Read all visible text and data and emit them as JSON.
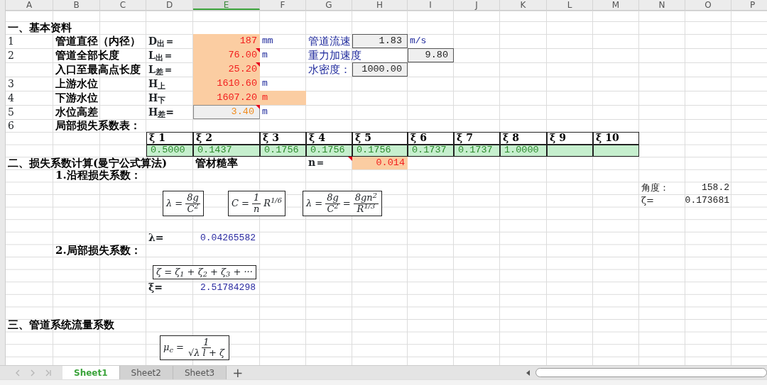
{
  "columns": [
    {
      "label": "A",
      "selected": false
    },
    {
      "label": "B",
      "selected": false
    },
    {
      "label": "C",
      "selected": false
    },
    {
      "label": "D",
      "selected": false
    },
    {
      "label": "E",
      "selected": true
    },
    {
      "label": "F",
      "selected": false
    },
    {
      "label": "G",
      "selected": false
    },
    {
      "label": "H",
      "selected": false
    },
    {
      "label": "I",
      "selected": false
    },
    {
      "label": "J",
      "selected": false
    },
    {
      "label": "K",
      "selected": false
    },
    {
      "label": "L",
      "selected": false
    },
    {
      "label": "M",
      "selected": false
    },
    {
      "label": "N",
      "selected": false
    },
    {
      "label": "O",
      "selected": false
    },
    {
      "label": "P",
      "selected": false
    }
  ],
  "rows": [
    {},
    {
      "cells": [
        {
          "kind": "heading",
          "text": "一、基本资料"
        }
      ]
    },
    {
      "cells": [
        {
          "kind": "index",
          "text": "1"
        },
        {
          "kind": "label",
          "text": "管道直径（内径）"
        },
        {},
        {
          "kind": "symbol",
          "text": "D$_{出}$＝"
        },
        {
          "kind": "input",
          "text": "187"
        },
        {
          "kind": "unit",
          "text": "mm"
        },
        {
          "kind": "blue-label",
          "text": "管道流速"
        },
        {
          "kind": "computed",
          "text": "1.83"
        },
        {
          "kind": "unit",
          "text": "m/s"
        }
      ]
    },
    {
      "cells": [
        {
          "kind": "index",
          "text": "2"
        },
        {
          "kind": "label",
          "text": "管道全部长度"
        },
        {},
        {
          "kind": "symbol",
          "text": "L$_{出}$＝"
        },
        {
          "kind": "input",
          "text": "76.00",
          "comment": true
        },
        {
          "kind": "unit",
          "text": "m"
        },
        {
          "kind": "blue-label",
          "text": "重力加速度"
        },
        {},
        {
          "kind": "computed",
          "text": "9.80"
        }
      ]
    },
    {
      "cells": [
        {},
        {
          "kind": "label",
          "text": "入口至最高点长度"
        },
        {},
        {
          "kind": "symbol",
          "text": "L$_{差}$＝"
        },
        {
          "kind": "input",
          "text": "25.20",
          "comment": true
        },
        {},
        {
          "kind": "blue-label",
          "text": "水密度："
        },
        {
          "kind": "computed",
          "text": "1000.00"
        }
      ]
    },
    {
      "cells": [
        {
          "kind": "index",
          "text": "3"
        },
        {
          "kind": "label",
          "text": "上游水位"
        },
        {},
        {
          "kind": "symbol",
          "text": "H$_{上}$"
        },
        {
          "kind": "input",
          "text": "1610.60"
        },
        {
          "kind": "unit",
          "text": "m"
        }
      ]
    },
    {
      "cells": [
        {
          "kind": "index",
          "text": "4"
        },
        {
          "kind": "label",
          "text": "下游水位"
        },
        {},
        {
          "kind": "symbol",
          "text": "H$_{下}$"
        },
        {
          "kind": "input",
          "text": "1607.20"
        },
        {
          "kind": "input-unit",
          "text": "m"
        }
      ]
    },
    {
      "cells": [
        {
          "kind": "index",
          "text": "5"
        },
        {
          "kind": "label",
          "text": "水位高差"
        },
        {},
        {
          "kind": "symbol",
          "text": "H$_{差}$="
        },
        {
          "kind": "computed-warn",
          "text": "3.40",
          "comment": true
        },
        {
          "kind": "unit",
          "text": "m"
        }
      ]
    },
    {
      "cells": [
        {
          "kind": "index",
          "text": "6"
        },
        {
          "kind": "label",
          "text": "局部损失系数表："
        }
      ]
    },
    {
      "cells": [
        {},
        {},
        {},
        {
          "kind": "coef-head",
          "text": "ξ 1"
        },
        {
          "kind": "coef-head",
          "text": "ξ 2"
        },
        {
          "kind": "coef-head",
          "text": "ξ 3"
        },
        {
          "kind": "coef-head",
          "text": "ξ 4"
        },
        {
          "kind": "coef-head",
          "text": "ξ 5"
        },
        {
          "kind": "coef-head",
          "text": "ξ 6"
        },
        {
          "kind": "coef-head",
          "text": "ξ 7"
        },
        {
          "kind": "coef-head",
          "text": "ξ 8"
        },
        {
          "kind": "coef-head",
          "text": "ξ 9"
        },
        {
          "kind": "coef-head",
          "text": "ξ 10"
        }
      ]
    },
    {
      "cells": [
        {},
        {},
        {},
        {
          "kind": "coef-value",
          "text": "0.5000"
        },
        {
          "kind": "coef-value",
          "text": "0.1437"
        },
        {
          "kind": "coef-value",
          "text": "0.1756"
        },
        {
          "kind": "coef-value",
          "text": "0.1756"
        },
        {
          "kind": "coef-value",
          "text": "0.1756"
        },
        {
          "kind": "coef-value",
          "text": "0.1737"
        },
        {
          "kind": "coef-value",
          "text": "0.1737"
        },
        {
          "kind": "coef-value",
          "text": "1.0000"
        },
        {
          "kind": "coef-value"
        },
        {
          "kind": "coef-value"
        }
      ]
    },
    {
      "cells": [
        {
          "kind": "heading",
          "text": "二、损失系数计算(曼宁公式算法)"
        },
        {},
        {},
        {},
        {
          "kind": "heading",
          "text": "管材糙率"
        },
        {},
        {
          "kind": "symbol",
          "text": "n＝",
          "comment": true
        },
        {
          "kind": "input",
          "text": "0.014"
        }
      ]
    },
    {
      "cells": [
        {},
        {
          "kind": "heading",
          "text": "1.沿程损失系数："
        }
      ]
    },
    {
      "cells": [
        {},
        {},
        {},
        {
          "kind": "formula",
          "terms": [
            {
              "text": "λ ="
            },
            {
              "num": "8g",
              "den": "C$^{2}$"
            }
          ]
        },
        {
          "kind": "formula",
          "terms": [
            {
              "text": "C ="
            },
            {
              "num": "1",
              "den": "n"
            },
            {
              "text": "R$^{1/6}$"
            }
          ]
        },
        {
          "kind": "formula",
          "terms": [
            {
              "text": "λ ="
            },
            {
              "num": "8g",
              "den": "C$^{2}$"
            },
            {
              "text": "="
            },
            {
              "num": "8gn$^{2}$",
              "den": "R$^{1/3}$"
            }
          ]
        },
        {},
        {},
        {},
        {},
        {},
        {},
        {},
        {
          "kind": "plain",
          "text": "角度："
        },
        {
          "kind": "plain-number",
          "text": "158.2"
        }
      ]
    },
    {
      "cells": [
        {},
        {},
        {},
        {},
        {},
        {},
        {},
        {},
        {},
        {},
        {},
        {},
        {},
        {
          "kind": "plain",
          "text": "ζ="
        },
        {
          "kind": "plain-number",
          "text": "0.173681"
        }
      ]
    },
    {},
    {},
    {
      "cells": [
        {},
        {},
        {},
        {
          "kind": "symbol",
          "text": "λ="
        },
        {
          "kind": "result",
          "text": "0.04265582"
        }
      ]
    },
    {
      "cells": [
        {},
        {
          "kind": "heading",
          "text": "2.局部损失系数："
        }
      ]
    },
    {
      "cells": [
        {},
        {},
        {},
        {
          "kind": "formula",
          "terms": [
            {
              "text": "ζ = ζ$_{1}$ + ζ$_{2}$ + ζ$_{3}$ + ···"
            }
          ]
        }
      ]
    },
    {},
    {
      "cells": [
        {},
        {},
        {},
        {
          "kind": "symbol",
          "text": "ξ="
        },
        {
          "kind": "result",
          "text": "2.51784298"
        }
      ]
    },
    {},
    {},
    {
      "cells": [
        {
          "kind": "heading",
          "text": "三、管道系统流量系数"
        }
      ]
    },
    {
      "cells": [
        {},
        {},
        {},
        {
          "kind": "formula",
          "terms": [
            {
              "text": "μ$_{c}$ ="
            },
            {
              "num": "1",
              "den": "√λ l + ζ"
            }
          ]
        }
      ]
    },
    {},
    {}
  ],
  "sheet_tabs": [
    {
      "label": "Sheet1",
      "selected": true
    },
    {
      "label": "Sheet2",
      "selected": false
    },
    {
      "label": "Sheet3",
      "selected": false
    }
  ],
  "add_sheet": "+"
}
